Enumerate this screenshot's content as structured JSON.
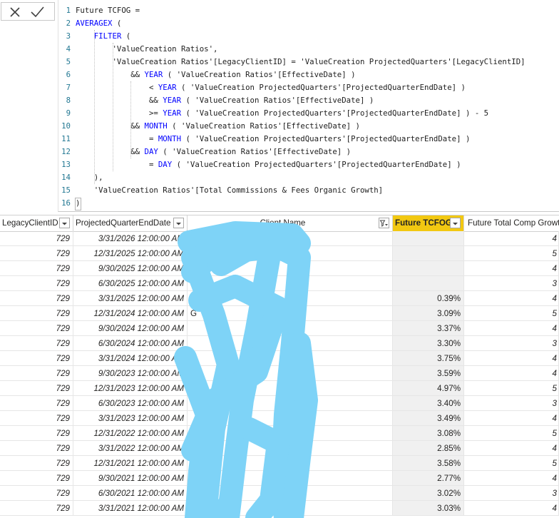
{
  "formula_bar": {
    "cancel_icon": "close-icon",
    "commit_icon": "checkmark-icon",
    "lines": [
      {
        "n": "1",
        "indent": 0,
        "parts": [
          {
            "t": "Future TCFOG =",
            "c": "plain"
          }
        ]
      },
      {
        "n": "2",
        "indent": 0,
        "parts": [
          {
            "t": "AVERAGEX",
            "c": "kw"
          },
          {
            "t": " (",
            "c": "plain"
          }
        ]
      },
      {
        "n": "3",
        "indent": 4,
        "parts": [
          {
            "t": "FILTER",
            "c": "kw"
          },
          {
            "t": " (",
            "c": "plain"
          }
        ]
      },
      {
        "n": "4",
        "indent": 8,
        "parts": [
          {
            "t": "'ValueCreation Ratios',",
            "c": "plain"
          }
        ]
      },
      {
        "n": "5",
        "indent": 8,
        "parts": [
          {
            "t": "'ValueCreation Ratios'[LegacyClientID] = 'ValueCreation ProjectedQuarters'[LegacyClientID]",
            "c": "plain"
          }
        ]
      },
      {
        "n": "6",
        "indent": 12,
        "parts": [
          {
            "t": "&& ",
            "c": "plain"
          },
          {
            "t": "YEAR",
            "c": "kw"
          },
          {
            "t": " ( 'ValueCreation Ratios'[EffectiveDate] )",
            "c": "plain"
          }
        ]
      },
      {
        "n": "7",
        "indent": 16,
        "parts": [
          {
            "t": "< ",
            "c": "plain"
          },
          {
            "t": "YEAR",
            "c": "kw"
          },
          {
            "t": " ( 'ValueCreation ProjectedQuarters'[ProjectedQuarterEndDate] )",
            "c": "plain"
          }
        ]
      },
      {
        "n": "8",
        "indent": 16,
        "parts": [
          {
            "t": "&& ",
            "c": "plain"
          },
          {
            "t": "YEAR",
            "c": "kw"
          },
          {
            "t": " ( 'ValueCreation Ratios'[EffectiveDate] )",
            "c": "plain"
          }
        ]
      },
      {
        "n": "9",
        "indent": 16,
        "parts": [
          {
            "t": ">= ",
            "c": "plain"
          },
          {
            "t": "YEAR",
            "c": "kw"
          },
          {
            "t": " ( 'ValueCreation ProjectedQuarters'[ProjectedQuarterEndDate] ) - 5",
            "c": "plain"
          }
        ]
      },
      {
        "n": "10",
        "indent": 12,
        "parts": [
          {
            "t": "&& ",
            "c": "plain"
          },
          {
            "t": "MONTH",
            "c": "kw"
          },
          {
            "t": " ( 'ValueCreation Ratios'[EffectiveDate] )",
            "c": "plain"
          }
        ]
      },
      {
        "n": "11",
        "indent": 16,
        "parts": [
          {
            "t": "= ",
            "c": "plain"
          },
          {
            "t": "MONTH",
            "c": "kw"
          },
          {
            "t": " ( 'ValueCreation ProjectedQuarters'[ProjectedQuarterEndDate] )",
            "c": "plain"
          }
        ]
      },
      {
        "n": "12",
        "indent": 12,
        "parts": [
          {
            "t": "&& ",
            "c": "plain"
          },
          {
            "t": "DAY",
            "c": "kw"
          },
          {
            "t": " ( 'ValueCreation Ratios'[EffectiveDate] )",
            "c": "plain"
          }
        ]
      },
      {
        "n": "13",
        "indent": 16,
        "parts": [
          {
            "t": "= ",
            "c": "plain"
          },
          {
            "t": "DAY",
            "c": "kw"
          },
          {
            "t": " ( 'ValueCreation ProjectedQuarters'[ProjectedQuarterEndDate] )",
            "c": "plain"
          }
        ]
      },
      {
        "n": "14",
        "indent": 4,
        "parts": [
          {
            "t": "),",
            "c": "plain"
          }
        ]
      },
      {
        "n": "15",
        "indent": 4,
        "parts": [
          {
            "t": "'ValueCreation Ratios'[Total Commissions & Fees Organic Growth]",
            "c": "plain"
          }
        ]
      },
      {
        "n": "16",
        "indent": 0,
        "parts": [
          {
            "t": ")",
            "c": "plain"
          }
        ]
      }
    ]
  },
  "table": {
    "columns": [
      {
        "key": "legacy_client_id",
        "label": "LegacyClientID",
        "icon": "dropdown-arrow-icon"
      },
      {
        "key": "projected_quarter_end_date",
        "label": "ProjectedQuarterEndDate",
        "icon": "dropdown-arrow-icon"
      },
      {
        "key": "client_name",
        "label": "Client Name",
        "icon": "filter-dropdown-icon"
      },
      {
        "key": "future_tcfog",
        "label": "Future TCFOG",
        "icon": "dropdown-arrow-icon",
        "selected": true
      },
      {
        "key": "future_total_comp_growth",
        "label": "Future Total Comp Growth",
        "icon": ""
      }
    ],
    "rows": [
      {
        "id": "729",
        "date": "3/31/2026 12:00:00 AM",
        "client": "",
        "tcfog": "",
        "next": "4"
      },
      {
        "id": "729",
        "date": "12/31/2025 12:00:00 AM",
        "client": "e",
        "tcfog": "",
        "next": "5"
      },
      {
        "id": "729",
        "date": "9/30/2025 12:00:00 AM",
        "client": "ance",
        "tcfog": "",
        "next": "4"
      },
      {
        "id": "729",
        "date": "6/30/2025 12:00:00 AM",
        "client": "& Insu",
        "tcfog": "",
        "next": "3"
      },
      {
        "id": "729",
        "date": "3/31/2025 12:00:00 AM",
        "client": "C",
        "tcfog": "0.39%",
        "next": "4"
      },
      {
        "id": "729",
        "date": "12/31/2024 12:00:00 AM",
        "client": "G",
        "tcfog": "3.09%",
        "next": "5"
      },
      {
        "id": "729",
        "date": "9/30/2024 12:00:00 AM",
        "client": "",
        "tcfog": "3.37%",
        "next": "4"
      },
      {
        "id": "729",
        "date": "6/30/2024 12:00:00 AM",
        "client": "",
        "tcfog": "3.30%",
        "next": "3"
      },
      {
        "id": "729",
        "date": "3/31/2024 12:00:00 AM",
        "client": "",
        "tcfog": "3.75%",
        "next": "4"
      },
      {
        "id": "729",
        "date": "9/30/2023 12:00:00 AM",
        "client": "o",
        "tcfog": "3.59%",
        "next": "4"
      },
      {
        "id": "729",
        "date": "12/31/2023 12:00:00 AM",
        "client": "",
        "tcfog": "4.97%",
        "next": "5"
      },
      {
        "id": "729",
        "date": "6/30/2023 12:00:00 AM",
        "client": "",
        "tcfog": "3.40%",
        "next": "3"
      },
      {
        "id": "729",
        "date": "3/31/2023 12:00:00 AM",
        "client": "",
        "tcfog": "3.49%",
        "next": "4"
      },
      {
        "id": "729",
        "date": "12/31/2022 12:00:00 AM",
        "client": "C",
        "tcfog": "3.08%",
        "next": "5"
      },
      {
        "id": "729",
        "date": "3/31/2022 12:00:00 AM",
        "client": "",
        "tcfog": "2.85%",
        "next": "4"
      },
      {
        "id": "729",
        "date": "12/31/2021 12:00:00 AM",
        "client": "",
        "tcfog": "3.58%",
        "next": "5"
      },
      {
        "id": "729",
        "date": "9/30/2021 12:00:00 AM",
        "client": "",
        "tcfog": "2.77%",
        "next": "4"
      },
      {
        "id": "729",
        "date": "6/30/2021 12:00:00 AM",
        "client": "",
        "tcfog": "3.02%",
        "next": "3"
      },
      {
        "id": "729",
        "date": "3/31/2021 12:00:00 AM",
        "client": "ory    Insura",
        "tcfog": "3.03%",
        "next": "4"
      }
    ]
  },
  "colors": {
    "keyword": "#0000ff",
    "line_number": "#237893",
    "selected_column": "#f2c811",
    "redaction": "#7ed3f7"
  }
}
